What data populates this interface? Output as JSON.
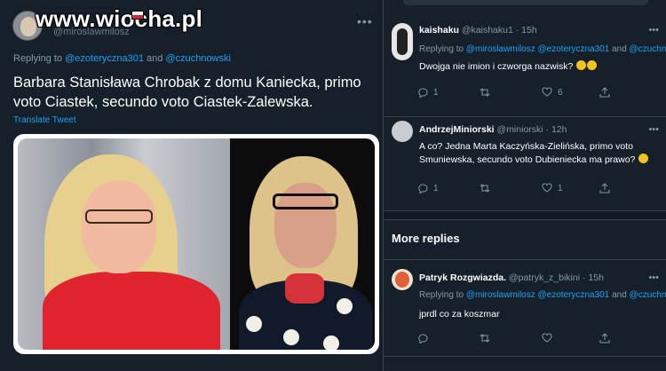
{
  "watermark": "www.wiocha.pl",
  "main_tweet": {
    "handle": "@miroslawmilosz",
    "replying_prefix": "Replying to",
    "reply_to_1": "@ezoteryczna301",
    "reply_and": "and",
    "reply_to_2": "@czuchnowski",
    "text": "Barbara Stanisława Chrobak z domu Kaniecka, primo voto Ciastek, secundo voto Ciastek-Zalewska.",
    "translate": "Translate Tweet"
  },
  "replies": [
    {
      "name": "kaishaku",
      "handle": "@kaishaku1",
      "time": "· 15h",
      "replying": "Replying to",
      "to_1": "@miroslawmilosz",
      "to_2": "@ezoteryczna301",
      "and": "and",
      "to_3": "@czuchnowski",
      "text": "Dwojga nie imion i czworga nazwisk?",
      "reply_count": "1",
      "retweet_count": "",
      "like_count": "6"
    },
    {
      "name": "AndrzejMiniorski",
      "handle": "@miniorski",
      "time": "· 12h",
      "replying": "",
      "text": "A co? Jedna Marta Kaczyńska-Zielińska, primo voto Smuniewska, secundo voto Dubieniecka ma prawo?",
      "reply_count": "1",
      "retweet_count": "",
      "like_count": "1"
    },
    {
      "name": "Patryk Rozgwiazda.",
      "handle": "@patryk_z_bikini",
      "time": "· 15h",
      "replying": "Replying to",
      "to_1": "@miroslawmilosz",
      "to_2": "@ezoteryczna301",
      "and": "and",
      "to_3": "@czuchnowski",
      "text": "jprdl co za koszmar",
      "reply_count": "",
      "retweet_count": "",
      "like_count": ""
    }
  ],
  "more_replies": "More replies",
  "colors": {
    "bg": "#15202b",
    "accent": "#1da1f2",
    "muted": "#8899a6",
    "border": "#38444d"
  },
  "icons": [
    "reply-icon",
    "retweet-icon",
    "like-icon",
    "share-icon",
    "more-icon"
  ]
}
